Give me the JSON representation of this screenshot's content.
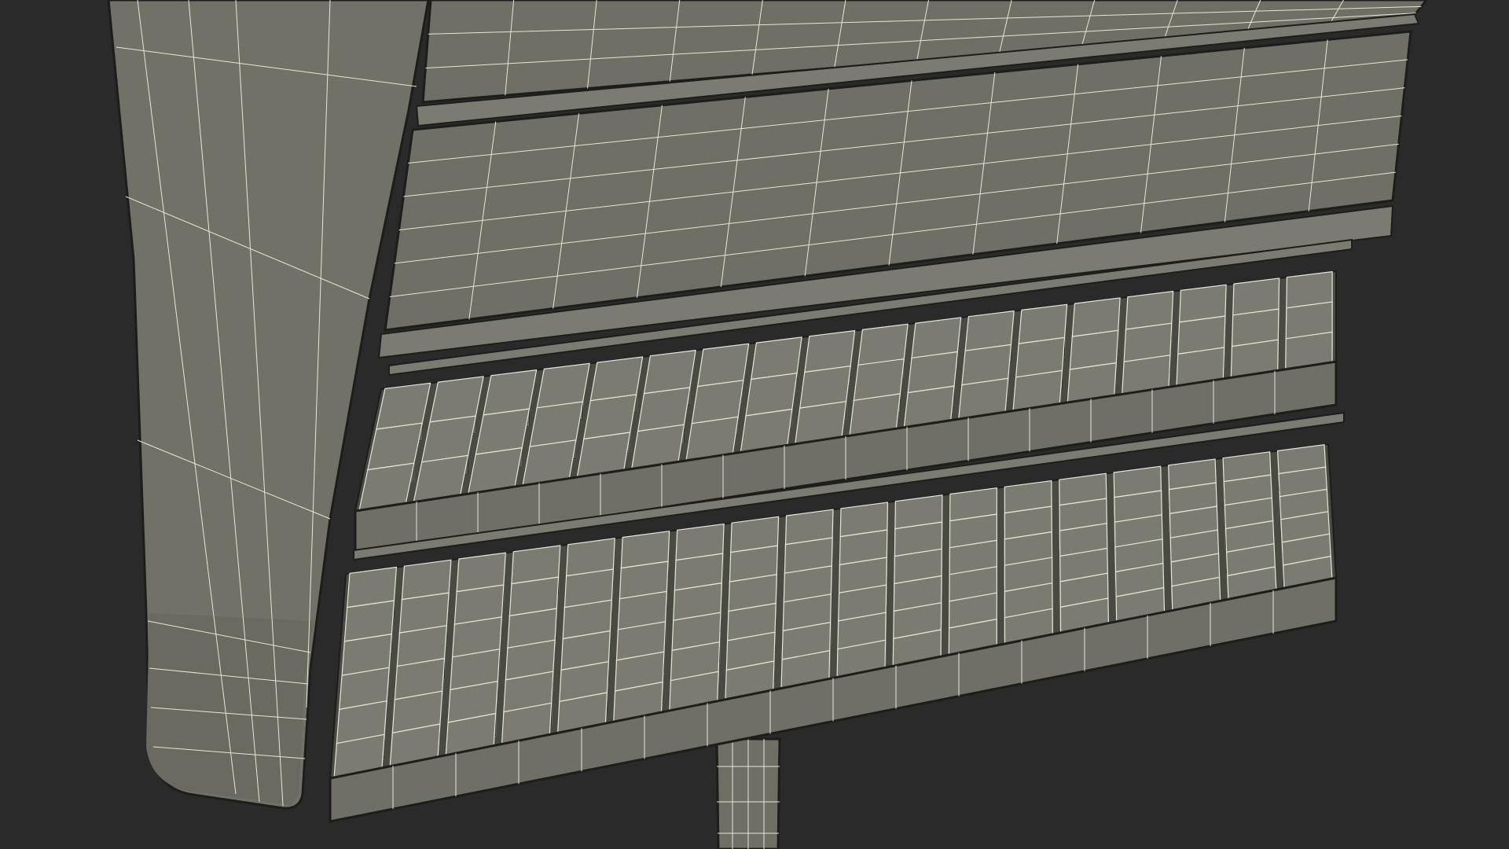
{
  "scene": {
    "subject": "wireframe-shelf-display-model",
    "colors": {
      "background": "#2a2a2a",
      "surface": "#6f6f66",
      "surface_light": "#7b7b71",
      "surface_dark": "#5c5c55",
      "interior": "#4a4a45",
      "wire": "#e6e6da",
      "edge": "#1d1d1b"
    },
    "upper_shelves": 3,
    "product_shelves": 2,
    "upper_row": {
      "columns": 18,
      "depth": 3
    },
    "lower_row": {
      "columns": 18,
      "depth": 6
    }
  }
}
